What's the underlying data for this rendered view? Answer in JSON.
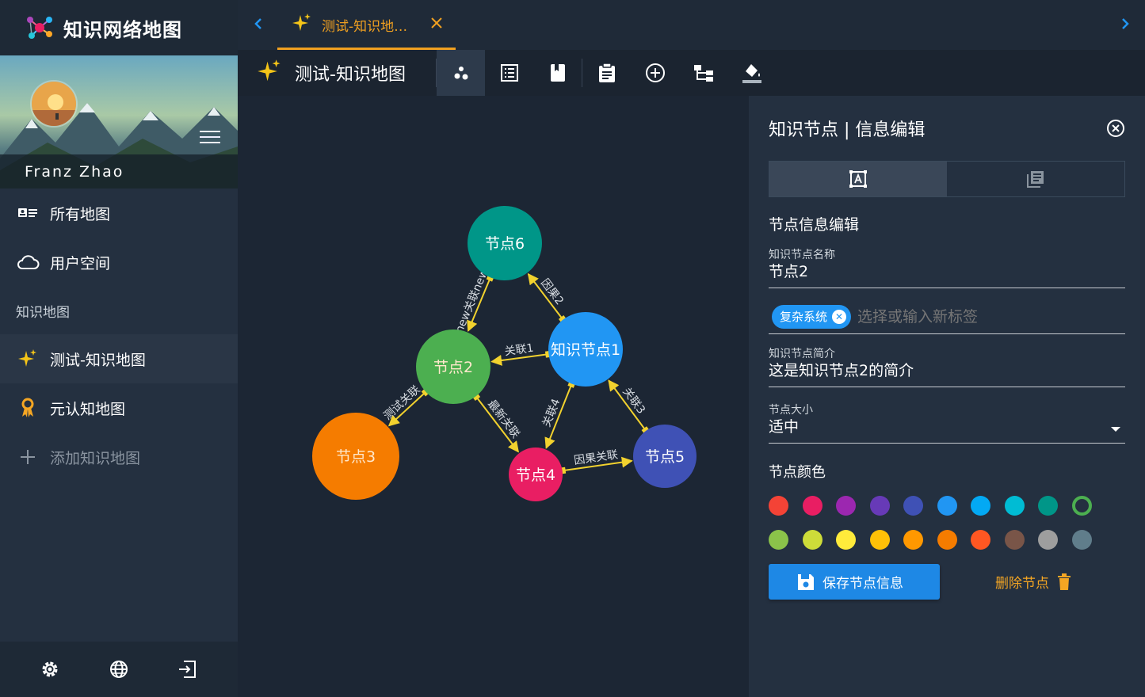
{
  "app": {
    "title": "知识网络地图"
  },
  "user": {
    "name": "Franz Zhao"
  },
  "nav": {
    "all_maps": "所有地图",
    "user_space": "用户空间",
    "section_label": "知识地图",
    "maps": [
      {
        "label": "测试-知识地图",
        "icon": "sparkle-icon",
        "active": true
      },
      {
        "label": "元认知地图",
        "icon": "ribbon-icon",
        "active": false
      }
    ],
    "add_map": "添加知识地图"
  },
  "tabs": [
    {
      "label": "测试-知识地…"
    }
  ],
  "toolbar": {
    "title": "测试-知识地图"
  },
  "graph": {
    "nodes": [
      {
        "id": "n6",
        "label": "节点6",
        "color": "#009688"
      },
      {
        "id": "n2",
        "label": "节点2",
        "color": "#4caf50"
      },
      {
        "id": "n1",
        "label": "知识节点1",
        "color": "#2196f3"
      },
      {
        "id": "n3",
        "label": "节点3",
        "color": "#f57c00"
      },
      {
        "id": "n4",
        "label": "节点4",
        "color": "#e91e63"
      },
      {
        "id": "n5",
        "label": "节点5",
        "color": "#3f51b5"
      }
    ],
    "edges": [
      {
        "from": "n6",
        "to": "n2",
        "label": "new关联new"
      },
      {
        "from": "n1",
        "to": "n6",
        "label": "因果2"
      },
      {
        "from": "n1",
        "to": "n2",
        "label": "关联1"
      },
      {
        "from": "n2",
        "to": "n3",
        "label": "测试关联"
      },
      {
        "from": "n2",
        "to": "n4",
        "label": "最新关联"
      },
      {
        "from": "n1",
        "to": "n4",
        "label": "关联4"
      },
      {
        "from": "n5",
        "to": "n1",
        "label": "关联3"
      },
      {
        "from": "n4",
        "to": "n5",
        "label": "因果关联"
      }
    ],
    "edge_color": "#f2d22e"
  },
  "panel": {
    "title": "知识节点 | 信息编辑",
    "section_title": "节点信息编辑",
    "name_label": "知识节点名称",
    "name_value": "节点2",
    "tags": [
      "复杂系统"
    ],
    "tag_placeholder": "选择或输入新标签",
    "intro_label": "知识节点简介",
    "intro_value": "这是知识节点2的简介",
    "size_label": "节点大小",
    "size_value": "适中",
    "color_label": "节点颜色",
    "colors_row1": [
      "#f44336",
      "#e91e63",
      "#9c27b0",
      "#673ab7",
      "#3f51b5",
      "#2196f3",
      "#03a9f4",
      "#00bcd4",
      "#009688",
      "#4caf50"
    ],
    "colors_row2": [
      "#8bc34a",
      "#cddc39",
      "#ffeb3b",
      "#ffc107",
      "#ff9800",
      "#f57c00",
      "#ff5722",
      "#795548",
      "#9e9e9e",
      "#607d8b"
    ],
    "selected_color": "#4caf50",
    "save_label": "保存节点信息",
    "delete_label": "删除节点"
  }
}
